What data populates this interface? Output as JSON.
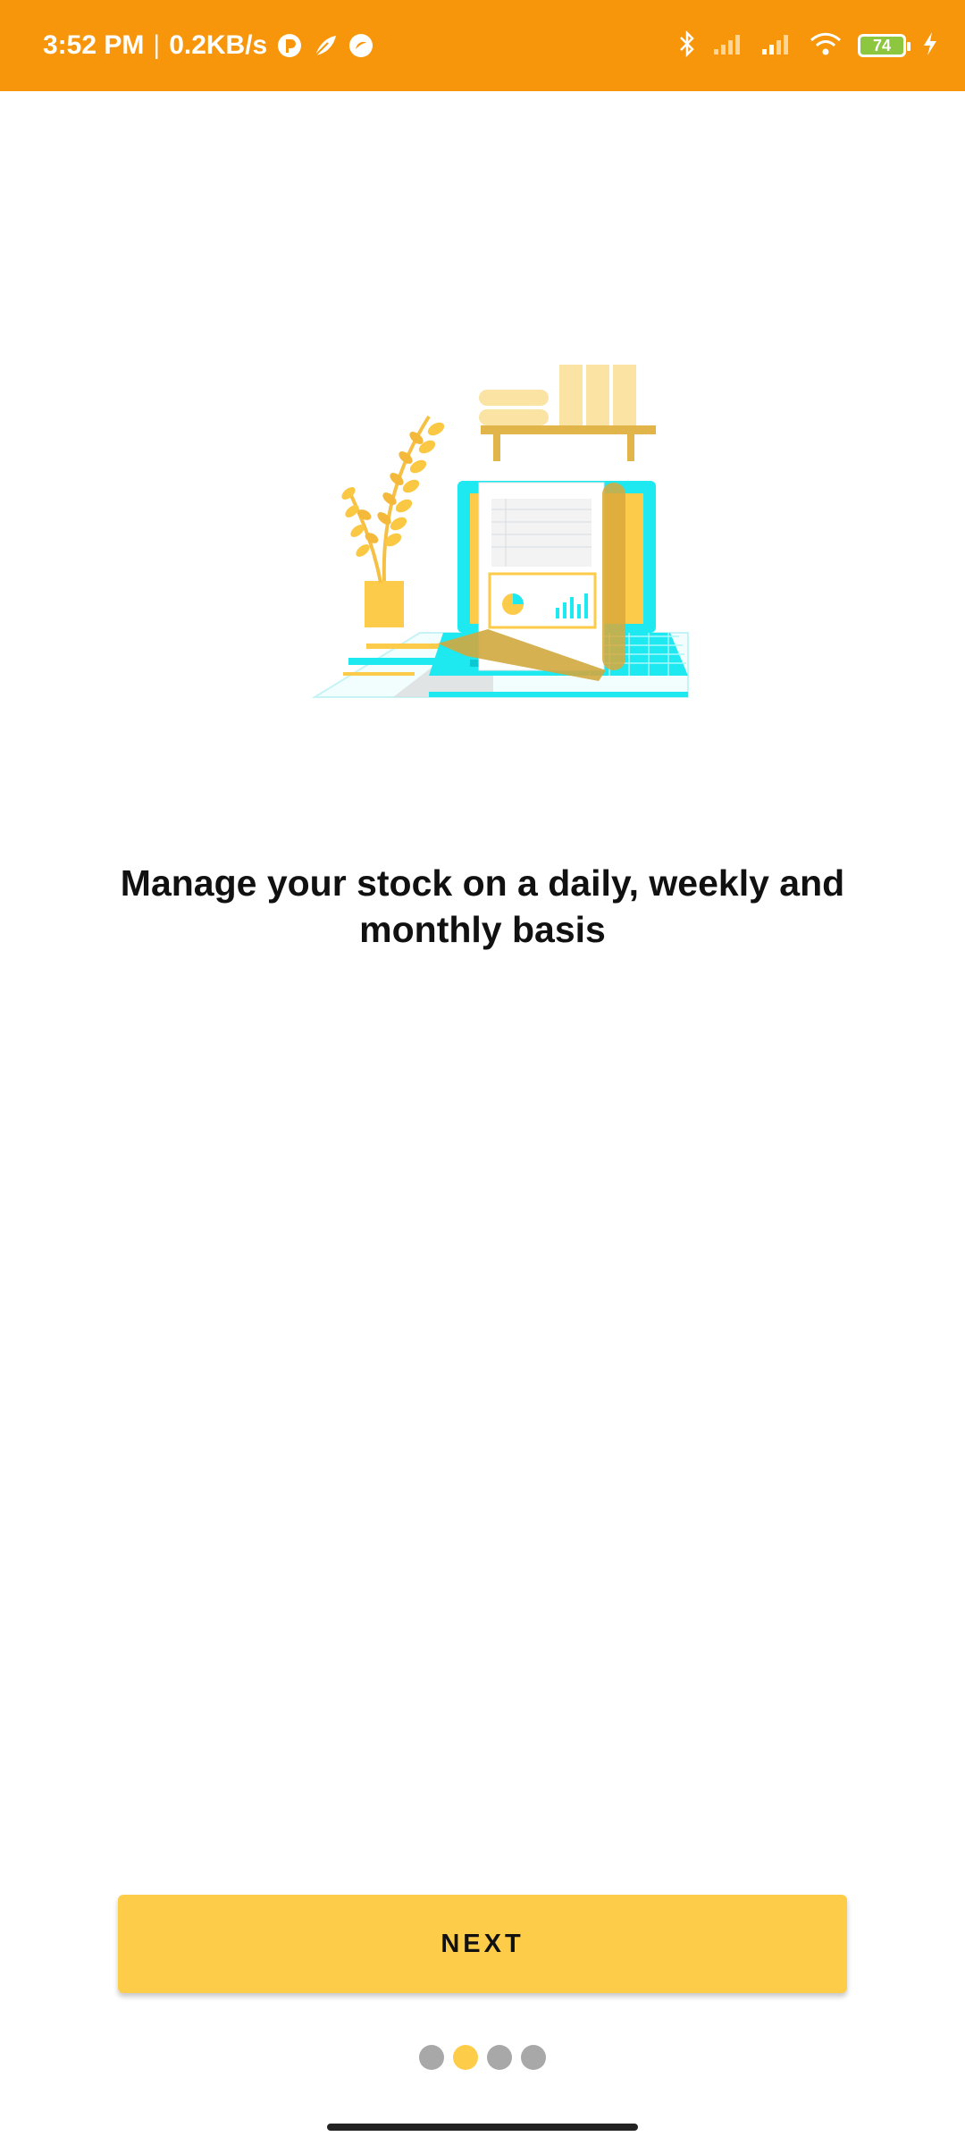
{
  "status_bar": {
    "time": "3:52 PM",
    "separator": "|",
    "speed": "0.2KB/s",
    "battery": "74",
    "icons": [
      "app-p-icon",
      "app-leaf-icon",
      "app-circle-icon",
      "bluetooth-icon",
      "signal-icon",
      "signal-icon",
      "wifi-icon",
      "battery-icon",
      "charging-icon"
    ]
  },
  "onboarding": {
    "headline": "Manage your stock on a daily, weekly and monthly basis",
    "next_label": "NEXT",
    "page_count": 4,
    "active_page": 2
  },
  "colors": {
    "status_bar": "#f7960a",
    "accent": "#fdcd4a",
    "dot_inactive": "#a8a8a8",
    "illustration_cyan": "#1ee8f0"
  }
}
